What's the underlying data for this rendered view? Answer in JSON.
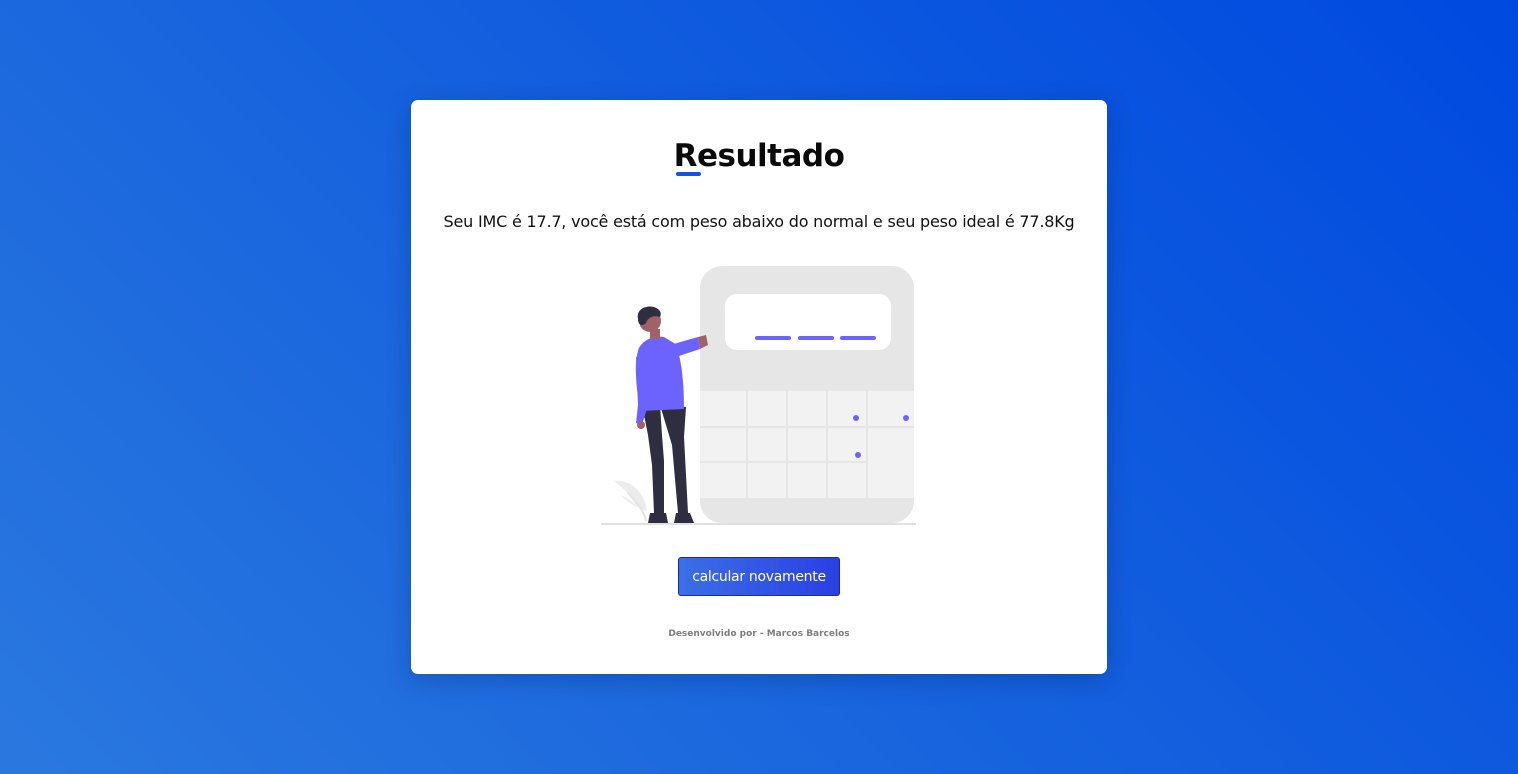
{
  "result": {
    "title": "Resultado",
    "message": "Seu IMC é 17.7, você está com peso abaixo do normal e seu peso ideal é 77.8Kg"
  },
  "illustration": {
    "subject": "person-with-calculator",
    "accent_color": "#6c63ff"
  },
  "actions": {
    "recalculate_label": "calcular novamente"
  },
  "footer": {
    "credit": "Desenvolvido por - Marcos Barcelos"
  },
  "colors": {
    "background_gradient_start": "#0049e0",
    "background_gradient_end": "#2a78df",
    "accent": "#1452e0",
    "button_start": "#3c6fe6",
    "button_end": "#2a3fe3"
  }
}
